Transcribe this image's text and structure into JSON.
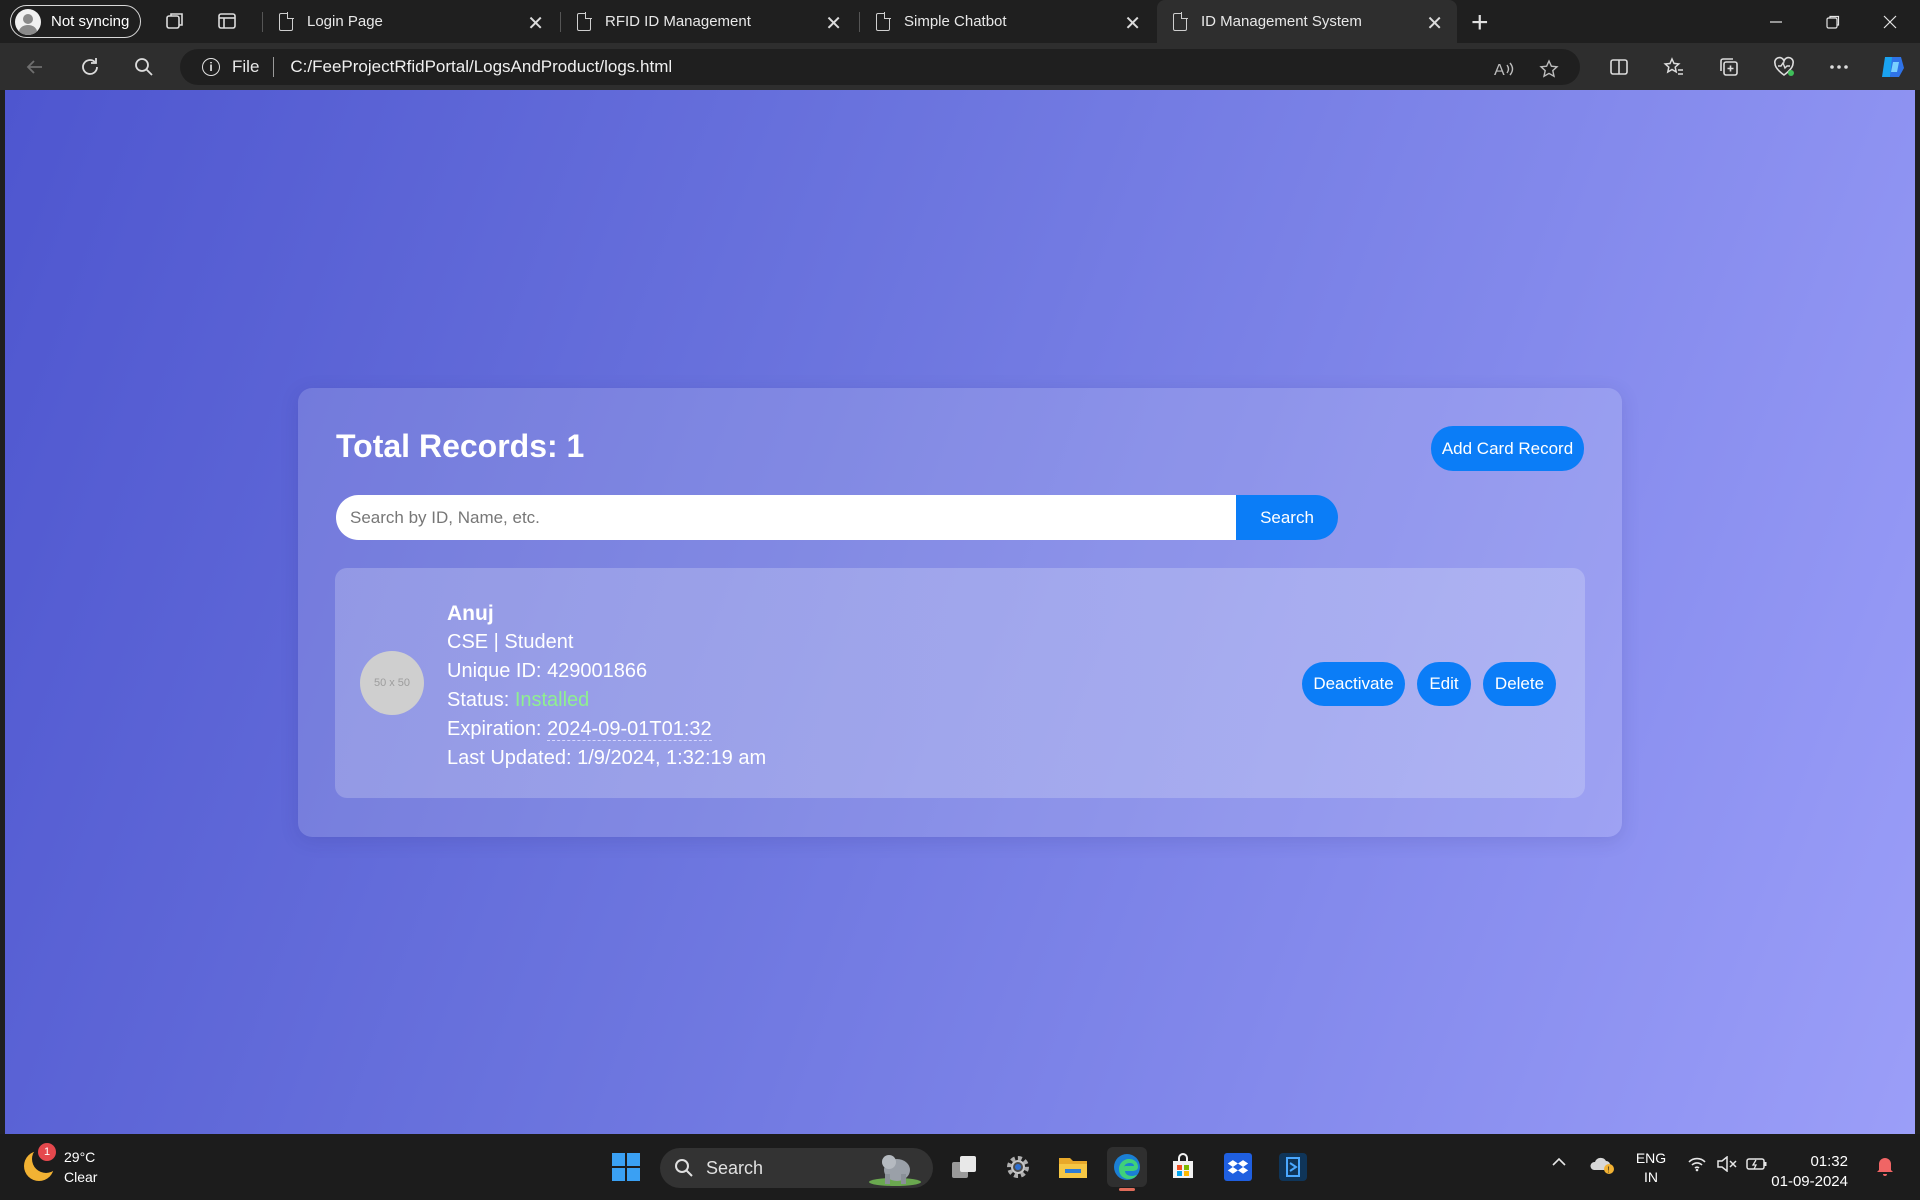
{
  "browser": {
    "profile_label": "Not syncing",
    "tabs": [
      {
        "title": "Login Page",
        "active": false
      },
      {
        "title": "RFID ID Management",
        "active": false
      },
      {
        "title": "Simple Chatbot",
        "active": false
      },
      {
        "title": "ID Management System",
        "active": true
      }
    ],
    "address": {
      "scheme": "File",
      "url": "C:/FeeProjectRfidPortal/LogsAndProduct/logs.html"
    }
  },
  "page": {
    "total_label": "Total Records: 1",
    "add_button": "Add Card Record",
    "search_placeholder": "Search by ID, Name, etc.",
    "search_button": "Search",
    "records": [
      {
        "thumb": "50 x 50",
        "name": "Anuj",
        "dept_role": "CSE | Student",
        "unique_id_label": "Unique ID: ",
        "unique_id": "429001866",
        "status_label": "Status: ",
        "status": "Installed",
        "expiration_label": "Expiration: ",
        "expiration": "2024-09-01T01:32",
        "last_updated_label": "Last Updated: ",
        "last_updated": "1/9/2024, 1:32:19 am",
        "actions": {
          "deactivate": "Deactivate",
          "edit": "Edit",
          "delete": "Delete"
        }
      }
    ]
  },
  "taskbar": {
    "weather": {
      "badge": "1",
      "temp": "29°C",
      "condition": "Clear"
    },
    "search_label": "Search",
    "lang": {
      "line1": "ENG",
      "line2": "IN"
    },
    "clock": {
      "time": "01:32",
      "date": "01-09-2024"
    }
  },
  "colors": {
    "accent": "#0b7df7",
    "status_installed": "#8ff08f",
    "gradient_start": "#4e56cf",
    "gradient_end": "#9b9ef8"
  }
}
